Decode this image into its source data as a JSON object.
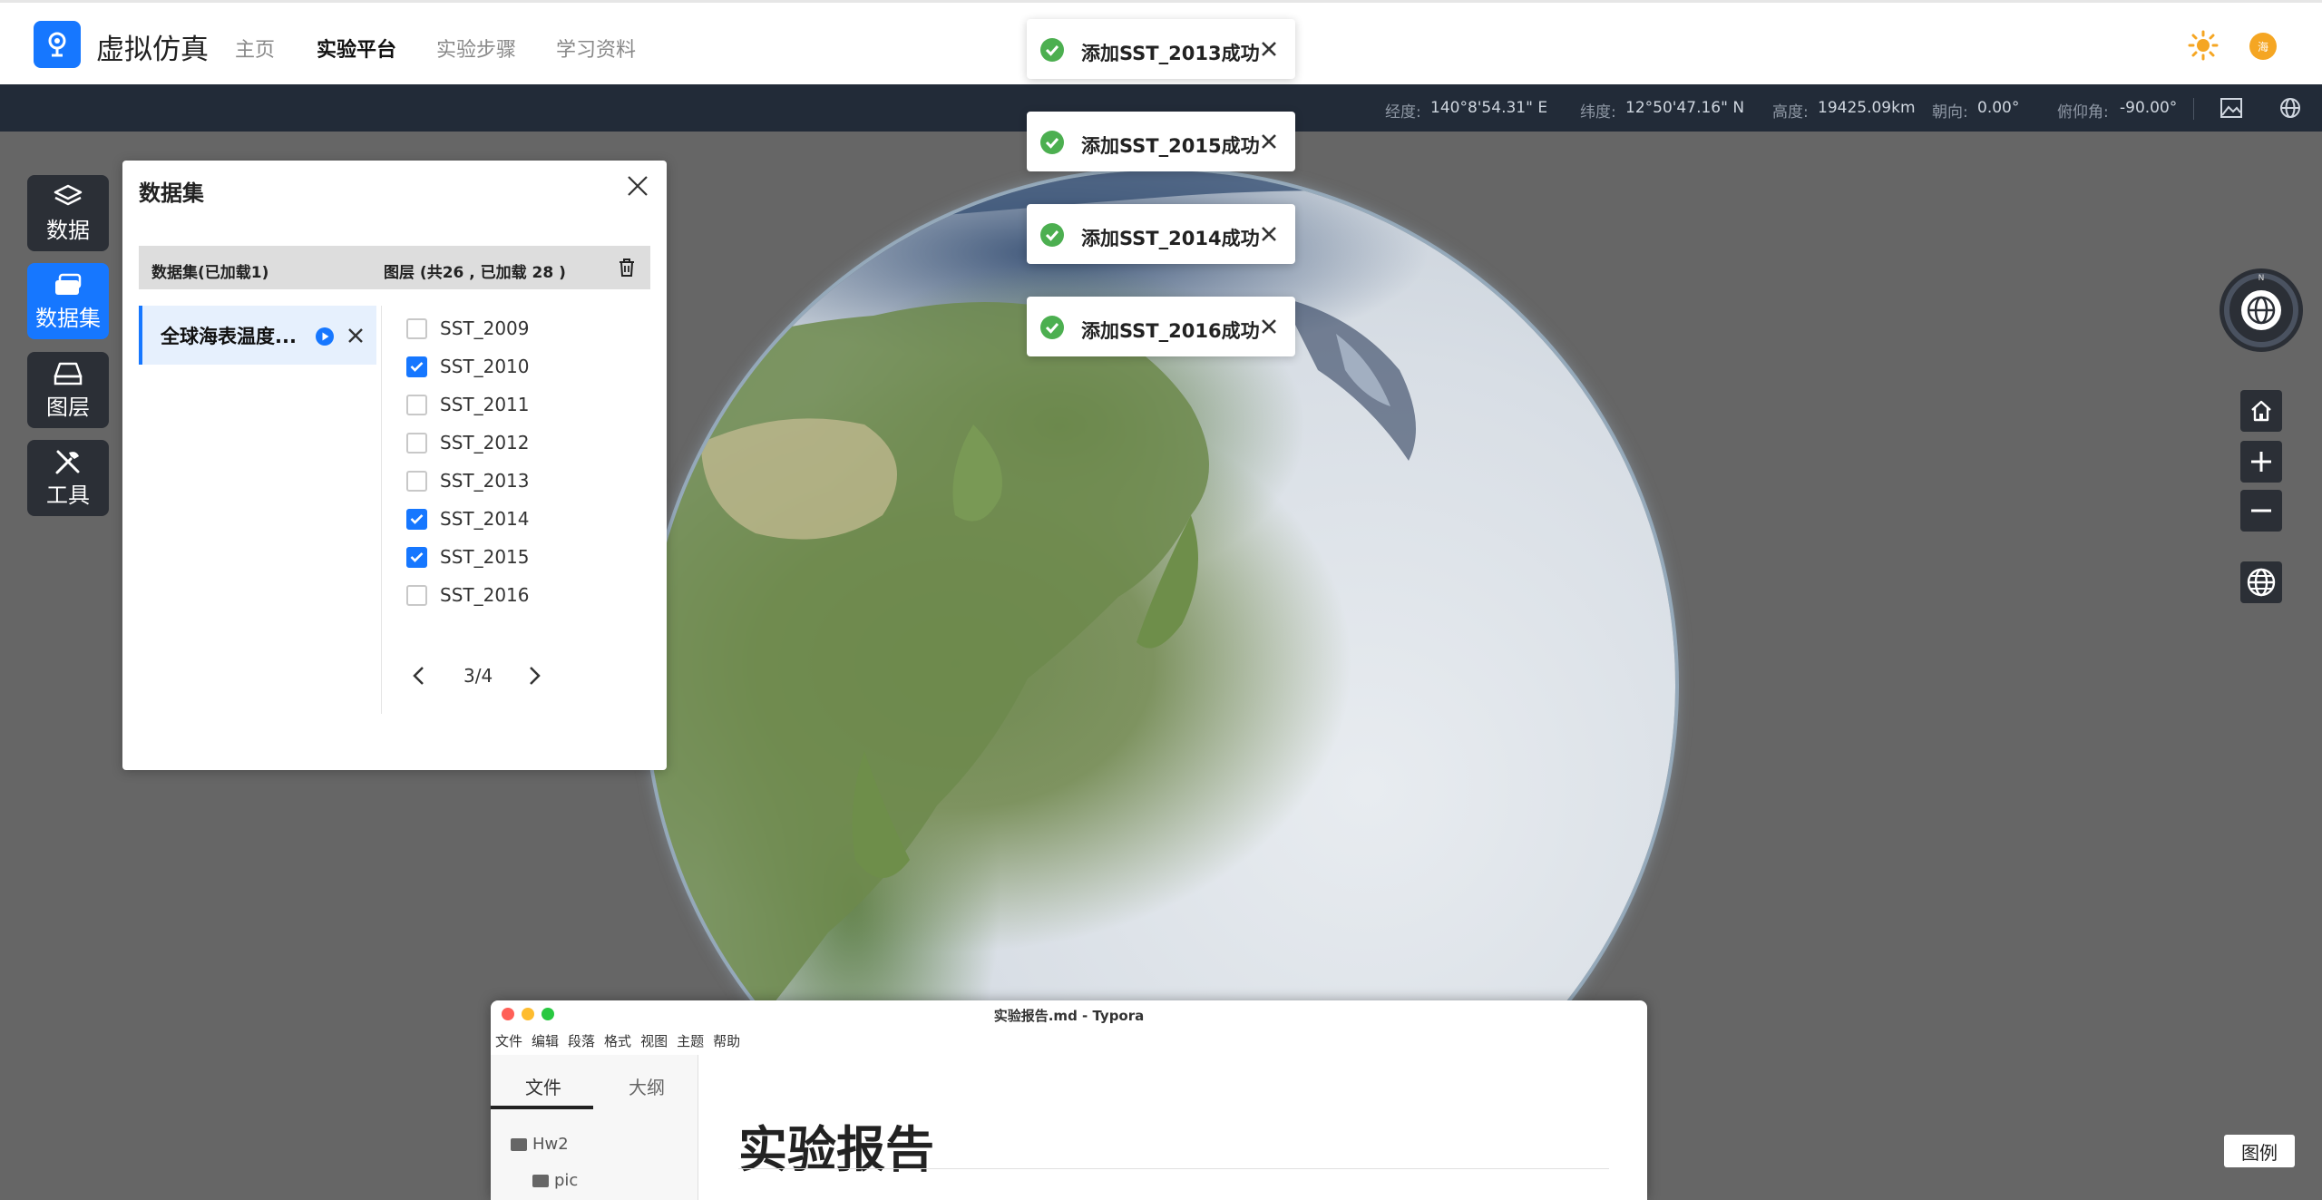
{
  "header": {
    "app_title": "虚拟仿真",
    "nav": [
      "主页",
      "实验平台",
      "实验步骤",
      "学习资料"
    ],
    "active_nav": "实验平台",
    "avatar_text": "海",
    "brand_color": "#1677ff"
  },
  "statusbar": {
    "longitude_label": "经度:",
    "longitude_value": "140°8'54.31\" E",
    "latitude_label": "纬度:",
    "latitude_value": "12°50'47.16\" N",
    "height_label": "高度:",
    "height_value": "19425.09km",
    "heading_label": "朝向:",
    "heading_value": "0.00°",
    "pitch_label": "俯仰角:",
    "pitch_value": "-90.00°"
  },
  "toolbar": {
    "items": [
      {
        "label": "数据",
        "icon": "layers-icon"
      },
      {
        "label": "数据集",
        "icon": "dataset-icon"
      },
      {
        "label": "图层",
        "icon": "layer-tray-icon"
      },
      {
        "label": "工具",
        "icon": "tools-icon"
      }
    ],
    "active": "数据集"
  },
  "dataset_panel": {
    "title": "数据集",
    "header_left": "数据集(已加载1)",
    "header_right": "图层 (共26 , 已加载 28 )",
    "dataset_name": "全球海表温度...",
    "layers": [
      {
        "label": "SST_2009",
        "checked": false
      },
      {
        "label": "SST_2010",
        "checked": true
      },
      {
        "label": "SST_2011",
        "checked": false
      },
      {
        "label": "SST_2012",
        "checked": false
      },
      {
        "label": "SST_2013",
        "checked": false
      },
      {
        "label": "SST_2014",
        "checked": true
      },
      {
        "label": "SST_2015",
        "checked": true
      },
      {
        "label": "SST_2016",
        "checked": false
      }
    ],
    "pager": "3/4"
  },
  "toasts": [
    {
      "text": "添加SST_2013成功"
    },
    {
      "text": "添加SST_2015成功"
    },
    {
      "text": "添加SST_2014成功"
    },
    {
      "text": "添加SST_2016成功"
    }
  ],
  "right_controls": {
    "compass_north": "N",
    "legend_label": "图例"
  },
  "typora": {
    "window_title": "实验报告.md - Typora",
    "menu": [
      "文件",
      "编辑",
      "段落",
      "格式",
      "视图",
      "主题",
      "帮助"
    ],
    "tabs": [
      "文件",
      "大纲"
    ],
    "tree": [
      "Hw2",
      "pic"
    ],
    "heading": "实验报告"
  }
}
